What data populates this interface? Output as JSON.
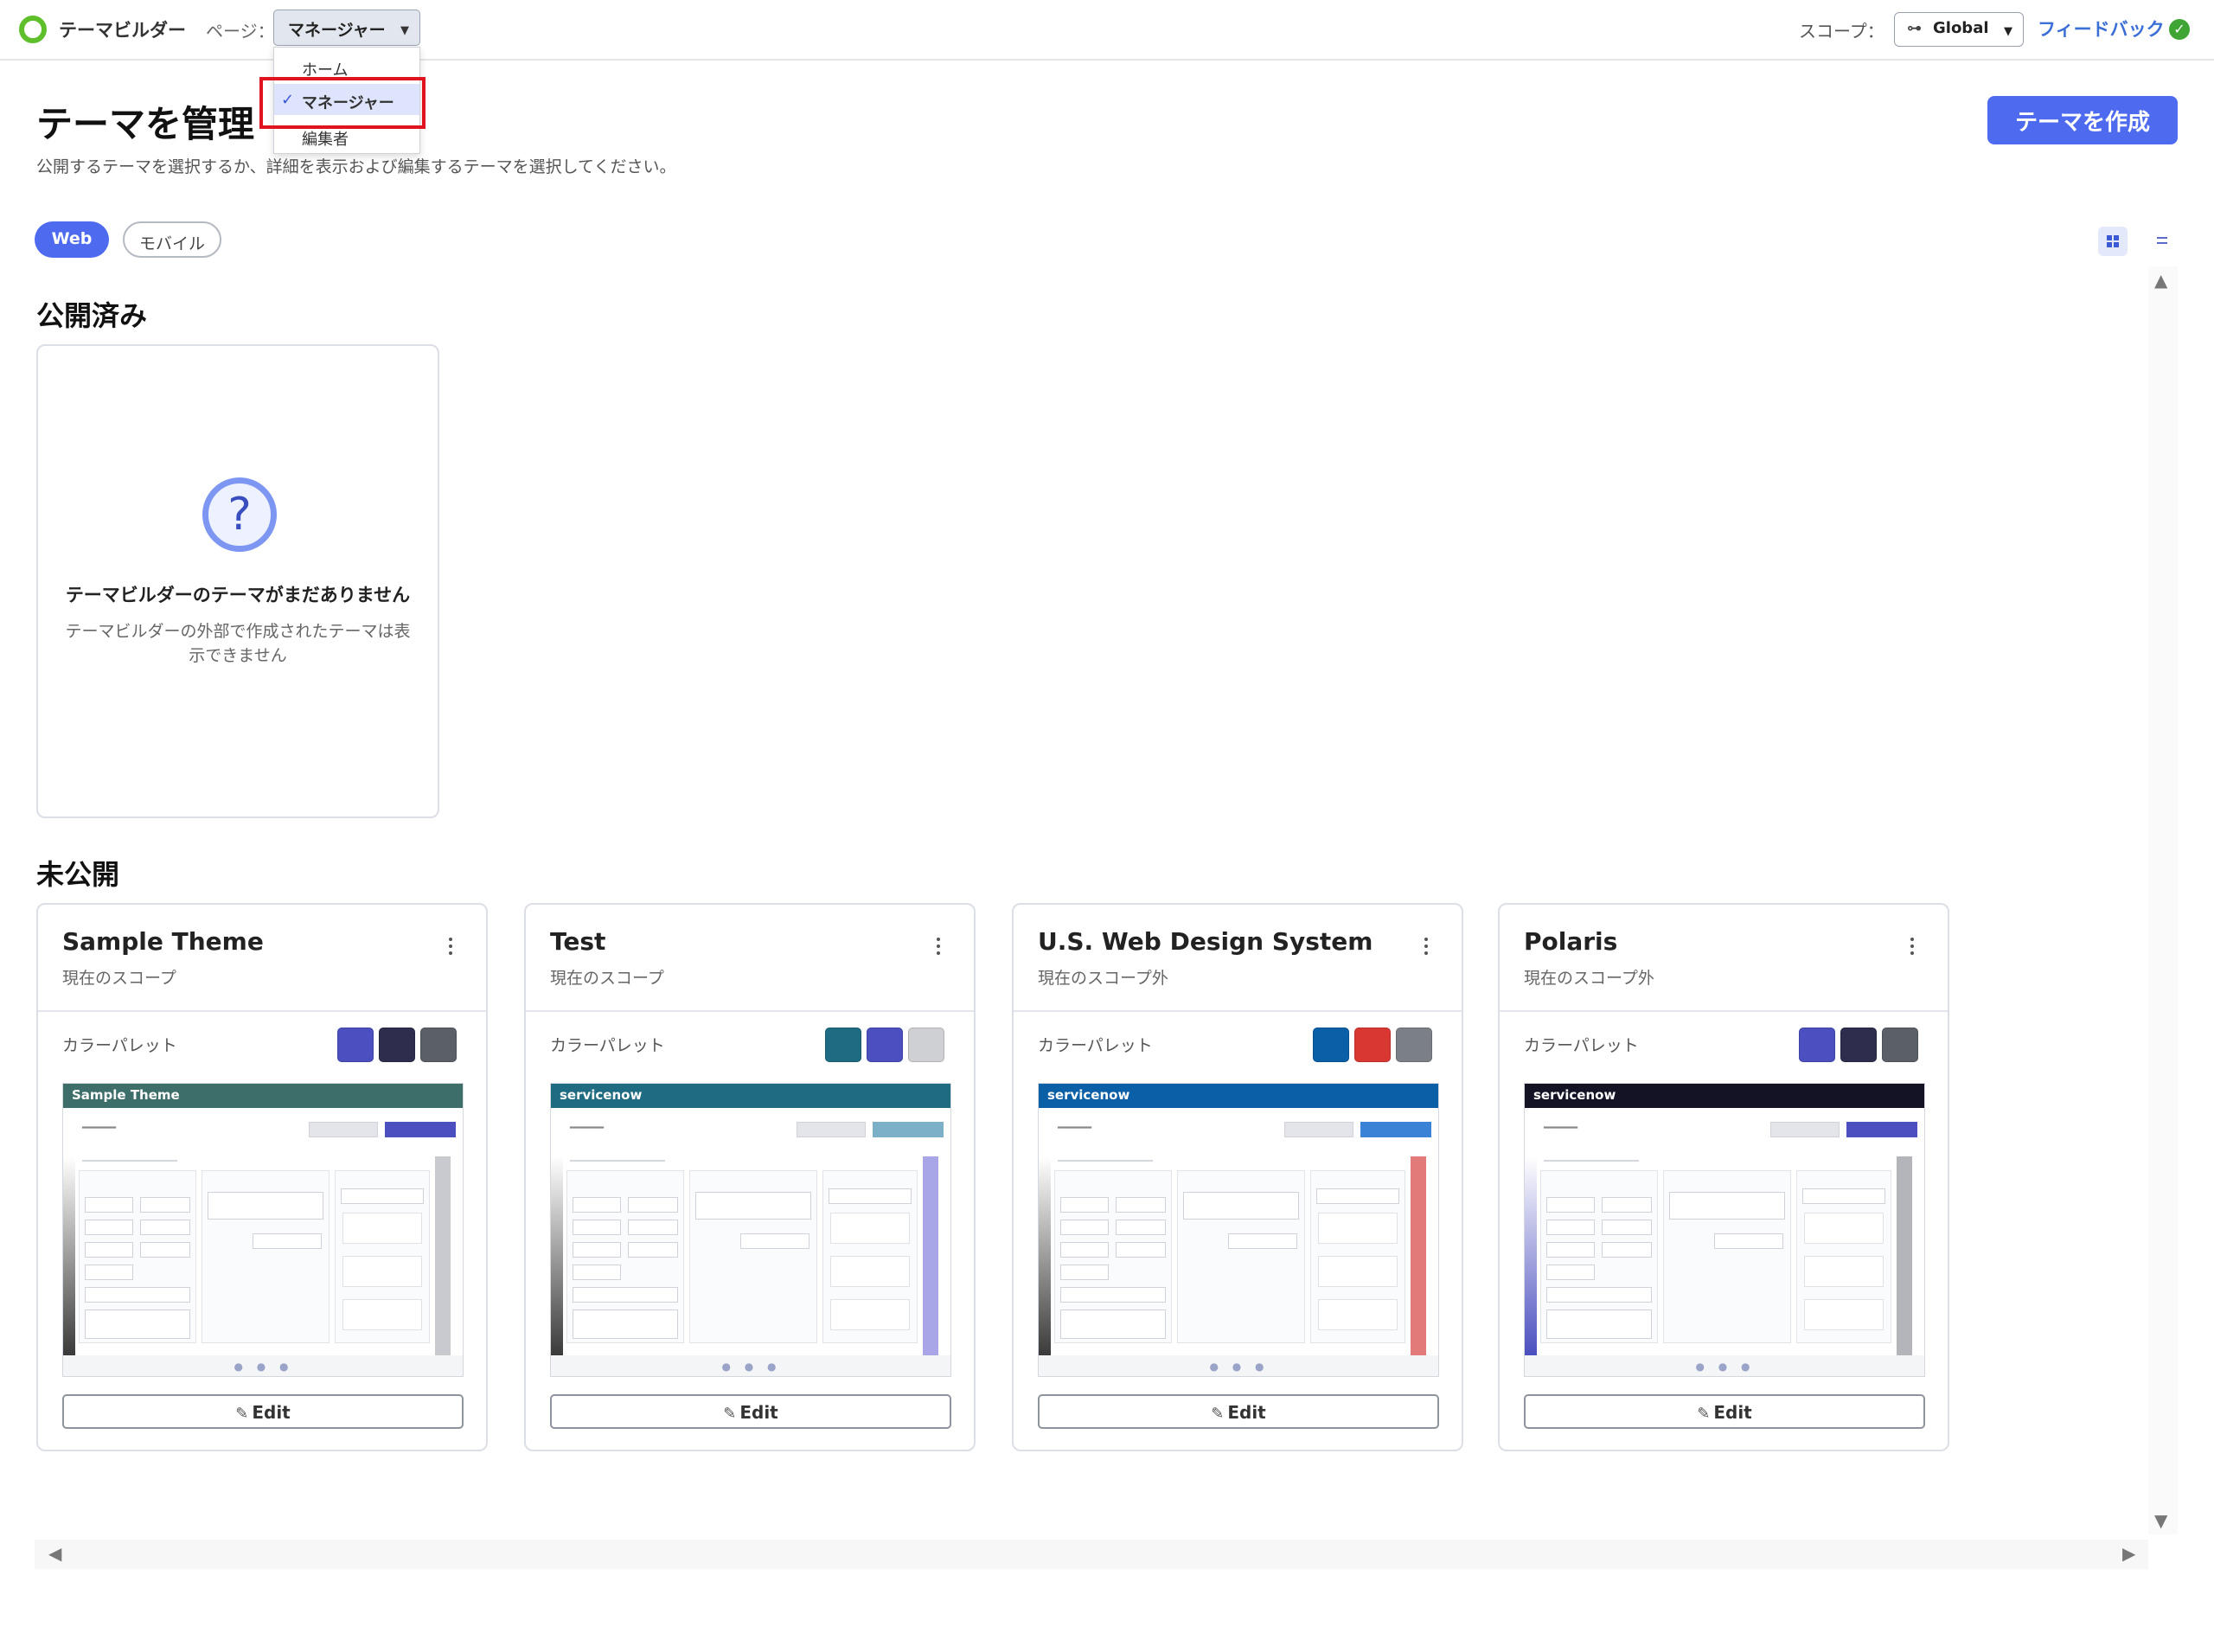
{
  "topbar": {
    "app_title": "テーマビルダー",
    "page_label": "ページ：",
    "page_select_value": "マネージャー",
    "page_options": [
      {
        "label": "ホーム",
        "selected": false
      },
      {
        "label": "マネージャー",
        "selected": true
      },
      {
        "label": "編集者",
        "selected": false
      }
    ],
    "scope_label": "スコープ：",
    "scope_value": "Global",
    "feedback_label": "フィードバック"
  },
  "header": {
    "title": "テーマを管理",
    "description": "公開するテーマを選択するか、詳細を表示および編集するテーマを選択してください。",
    "create_button": "テーマを作成"
  },
  "filters": {
    "web": "Web",
    "mobile": "モバイル"
  },
  "published": {
    "section_title": "公開済み",
    "empty_title": "テーマビルダーのテーマがまだありません",
    "empty_text": "テーマビルダーの外部で作成されたテーマは表示できません"
  },
  "unpublished": {
    "section_title": "未公開",
    "palette_label": "カラーパレット",
    "edit_label": "Edit",
    "themes": [
      {
        "name": "Sample Theme",
        "scope": "現在のスコープ",
        "brand": "Sample Theme",
        "colors": [
          "#4b4fbf",
          "#2e2d4d",
          "#5b6068"
        ],
        "header_color": "#3d6e6a",
        "sidebar_color": "#3a3a3a",
        "accent": "#4b4fbf",
        "right_color": "#c9cacf"
      },
      {
        "name": "Test",
        "scope": "現在のスコープ",
        "brand": "servicenow",
        "colors": [
          "#1f6b82",
          "#4b4fbf",
          "#cfd0d3"
        ],
        "header_color": "#1f6b82",
        "sidebar_color": "#3a3a3a",
        "accent": "#7bb0c8",
        "right_color": "#a8a6e6"
      },
      {
        "name": "U.S. Web Design System",
        "scope": "現在のスコープ外",
        "brand": "servicenow",
        "colors": [
          "#0a5fa6",
          "#d93832",
          "#7b7f86"
        ],
        "header_color": "#0a5fa6",
        "sidebar_color": "#3a3a3a",
        "accent": "#3a82d6",
        "right_color": "#e37a7a"
      },
      {
        "name": "Polaris",
        "scope": "現在のスコープ外",
        "brand": "servicenow",
        "colors": [
          "#4b4fbf",
          "#2e2d4d",
          "#5b6068"
        ],
        "header_color": "#141326",
        "sidebar_color": "#4b4fbf",
        "accent": "#4b4fbf",
        "right_color": "#b4b5bb"
      }
    ]
  }
}
